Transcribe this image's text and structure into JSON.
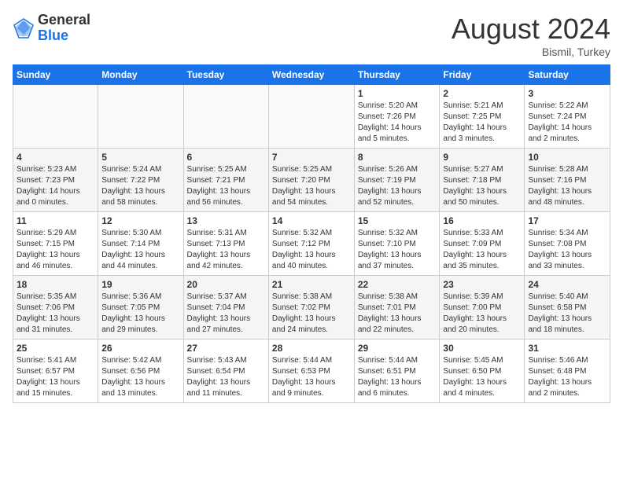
{
  "logo": {
    "general": "General",
    "blue": "Blue"
  },
  "title": {
    "month_year": "August 2024",
    "location": "Bismil, Turkey"
  },
  "weekdays": [
    "Sunday",
    "Monday",
    "Tuesday",
    "Wednesday",
    "Thursday",
    "Friday",
    "Saturday"
  ],
  "weeks": [
    {
      "days": [
        {
          "num": "",
          "info": ""
        },
        {
          "num": "",
          "info": ""
        },
        {
          "num": "",
          "info": ""
        },
        {
          "num": "",
          "info": ""
        },
        {
          "num": "1",
          "info": "Sunrise: 5:20 AM\nSunset: 7:26 PM\nDaylight: 14 hours\nand 5 minutes."
        },
        {
          "num": "2",
          "info": "Sunrise: 5:21 AM\nSunset: 7:25 PM\nDaylight: 14 hours\nand 3 minutes."
        },
        {
          "num": "3",
          "info": "Sunrise: 5:22 AM\nSunset: 7:24 PM\nDaylight: 14 hours\nand 2 minutes."
        }
      ]
    },
    {
      "days": [
        {
          "num": "4",
          "info": "Sunrise: 5:23 AM\nSunset: 7:23 PM\nDaylight: 14 hours\nand 0 minutes."
        },
        {
          "num": "5",
          "info": "Sunrise: 5:24 AM\nSunset: 7:22 PM\nDaylight: 13 hours\nand 58 minutes."
        },
        {
          "num": "6",
          "info": "Sunrise: 5:25 AM\nSunset: 7:21 PM\nDaylight: 13 hours\nand 56 minutes."
        },
        {
          "num": "7",
          "info": "Sunrise: 5:25 AM\nSunset: 7:20 PM\nDaylight: 13 hours\nand 54 minutes."
        },
        {
          "num": "8",
          "info": "Sunrise: 5:26 AM\nSunset: 7:19 PM\nDaylight: 13 hours\nand 52 minutes."
        },
        {
          "num": "9",
          "info": "Sunrise: 5:27 AM\nSunset: 7:18 PM\nDaylight: 13 hours\nand 50 minutes."
        },
        {
          "num": "10",
          "info": "Sunrise: 5:28 AM\nSunset: 7:16 PM\nDaylight: 13 hours\nand 48 minutes."
        }
      ]
    },
    {
      "days": [
        {
          "num": "11",
          "info": "Sunrise: 5:29 AM\nSunset: 7:15 PM\nDaylight: 13 hours\nand 46 minutes."
        },
        {
          "num": "12",
          "info": "Sunrise: 5:30 AM\nSunset: 7:14 PM\nDaylight: 13 hours\nand 44 minutes."
        },
        {
          "num": "13",
          "info": "Sunrise: 5:31 AM\nSunset: 7:13 PM\nDaylight: 13 hours\nand 42 minutes."
        },
        {
          "num": "14",
          "info": "Sunrise: 5:32 AM\nSunset: 7:12 PM\nDaylight: 13 hours\nand 40 minutes."
        },
        {
          "num": "15",
          "info": "Sunrise: 5:32 AM\nSunset: 7:10 PM\nDaylight: 13 hours\nand 37 minutes."
        },
        {
          "num": "16",
          "info": "Sunrise: 5:33 AM\nSunset: 7:09 PM\nDaylight: 13 hours\nand 35 minutes."
        },
        {
          "num": "17",
          "info": "Sunrise: 5:34 AM\nSunset: 7:08 PM\nDaylight: 13 hours\nand 33 minutes."
        }
      ]
    },
    {
      "days": [
        {
          "num": "18",
          "info": "Sunrise: 5:35 AM\nSunset: 7:06 PM\nDaylight: 13 hours\nand 31 minutes."
        },
        {
          "num": "19",
          "info": "Sunrise: 5:36 AM\nSunset: 7:05 PM\nDaylight: 13 hours\nand 29 minutes."
        },
        {
          "num": "20",
          "info": "Sunrise: 5:37 AM\nSunset: 7:04 PM\nDaylight: 13 hours\nand 27 minutes."
        },
        {
          "num": "21",
          "info": "Sunrise: 5:38 AM\nSunset: 7:02 PM\nDaylight: 13 hours\nand 24 minutes."
        },
        {
          "num": "22",
          "info": "Sunrise: 5:38 AM\nSunset: 7:01 PM\nDaylight: 13 hours\nand 22 minutes."
        },
        {
          "num": "23",
          "info": "Sunrise: 5:39 AM\nSunset: 7:00 PM\nDaylight: 13 hours\nand 20 minutes."
        },
        {
          "num": "24",
          "info": "Sunrise: 5:40 AM\nSunset: 6:58 PM\nDaylight: 13 hours\nand 18 minutes."
        }
      ]
    },
    {
      "days": [
        {
          "num": "25",
          "info": "Sunrise: 5:41 AM\nSunset: 6:57 PM\nDaylight: 13 hours\nand 15 minutes."
        },
        {
          "num": "26",
          "info": "Sunrise: 5:42 AM\nSunset: 6:56 PM\nDaylight: 13 hours\nand 13 minutes."
        },
        {
          "num": "27",
          "info": "Sunrise: 5:43 AM\nSunset: 6:54 PM\nDaylight: 13 hours\nand 11 minutes."
        },
        {
          "num": "28",
          "info": "Sunrise: 5:44 AM\nSunset: 6:53 PM\nDaylight: 13 hours\nand 9 minutes."
        },
        {
          "num": "29",
          "info": "Sunrise: 5:44 AM\nSunset: 6:51 PM\nDaylight: 13 hours\nand 6 minutes."
        },
        {
          "num": "30",
          "info": "Sunrise: 5:45 AM\nSunset: 6:50 PM\nDaylight: 13 hours\nand 4 minutes."
        },
        {
          "num": "31",
          "info": "Sunrise: 5:46 AM\nSunset: 6:48 PM\nDaylight: 13 hours\nand 2 minutes."
        }
      ]
    }
  ]
}
